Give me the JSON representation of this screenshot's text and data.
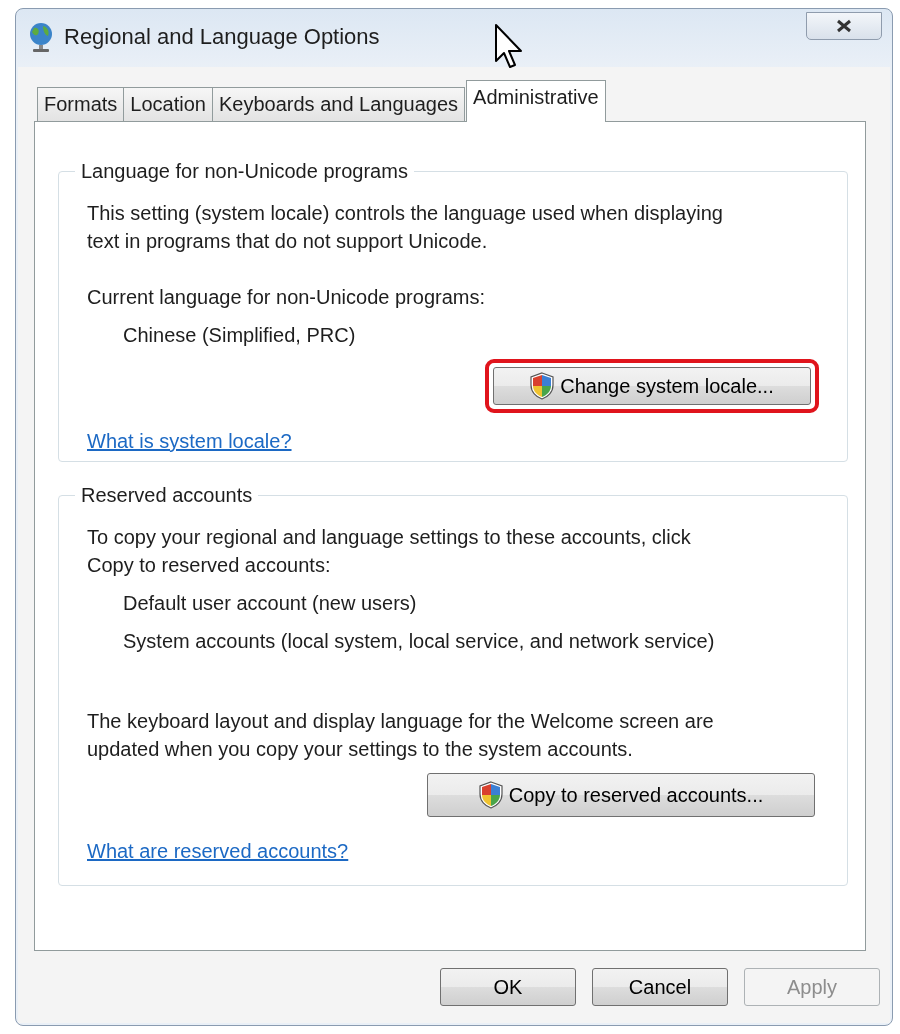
{
  "window": {
    "title": "Regional and Language Options"
  },
  "tabs": [
    {
      "label": "Formats",
      "selected": false
    },
    {
      "label": "Location",
      "selected": false
    },
    {
      "label": "Keyboards and Languages",
      "selected": false
    },
    {
      "label": "Administrative",
      "selected": true
    }
  ],
  "groups": [
    {
      "title": "Language for non-Unicode programs",
      "items": [
        {
          "kind": "paragraph",
          "text": "This setting (system locale) controls the language used when displaying\ntext in programs that do not support Unicode."
        },
        {
          "kind": "label",
          "text": "Current language for non-Unicode programs:"
        },
        {
          "kind": "indented",
          "text": "Chinese (Simplified, PRC)"
        },
        {
          "kind": "button",
          "label": "Change system locale...",
          "shield": true,
          "highlighted": true
        },
        {
          "kind": "link",
          "text": "What is system locale?"
        }
      ]
    },
    {
      "title": "Reserved accounts",
      "items": [
        {
          "kind": "paragraph",
          "text": "To copy your regional and language settings to these accounts, click\nCopy to reserved accounts:"
        },
        {
          "kind": "indented",
          "text": "Default user account (new users)"
        },
        {
          "kind": "indented",
          "text": "System accounts (local system, local service, and network service)"
        },
        {
          "kind": "paragraph",
          "text": "The keyboard layout and display language for the Welcome screen are\nupdated when you copy your settings to the system accounts."
        },
        {
          "kind": "button",
          "label": "Copy to reserved accounts...",
          "shield": true,
          "highlighted": false
        },
        {
          "kind": "link",
          "text": "What are reserved accounts?"
        }
      ]
    }
  ],
  "buttons": [
    {
      "label": "OK",
      "disabled": false
    },
    {
      "label": "Cancel",
      "disabled": false
    },
    {
      "label": "Apply",
      "disabled": true
    }
  ]
}
